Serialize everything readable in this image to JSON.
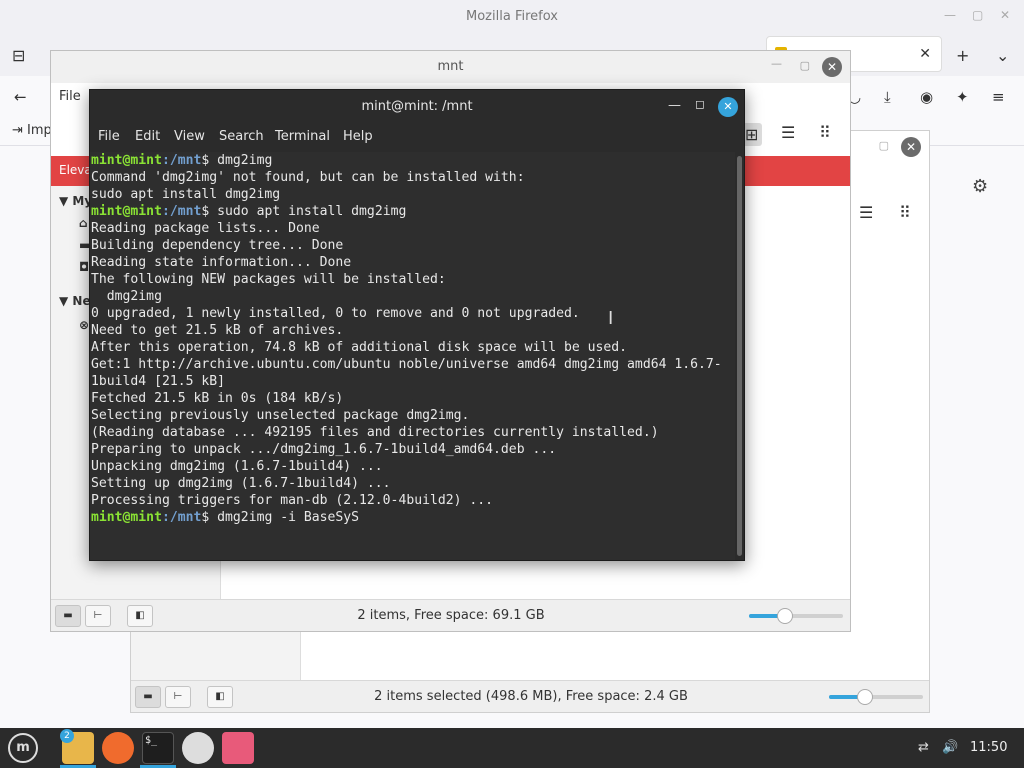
{
  "firefox": {
    "title": "Mozilla Firefox",
    "bookmark": "Imp",
    "tab_close": "✕"
  },
  "nemo_back": {
    "status_text": "2 items selected (498.6 MB), Free space: 2.4 GB",
    "zoom_level": 0.38
  },
  "nemo_mnt": {
    "title": "mnt",
    "menu_file": "File",
    "banner_text": "Eleva",
    "sidebar_group_1": "My",
    "sidebar_group_2": "Ne",
    "status_text": "2 items, Free space: 69.1 GB",
    "zoom_level": 0.38
  },
  "terminal": {
    "title": "mint@mint: /mnt",
    "menu": [
      "File",
      "Edit",
      "View",
      "Search",
      "Terminal",
      "Help"
    ],
    "prompt_user": "mint@mint",
    "prompt_path": ":/mnt",
    "prompt_suffix": "$ ",
    "lines": [
      {
        "type": "cmd",
        "text": "dmg2img"
      },
      {
        "type": "out",
        "text": "Command 'dmg2img' not found, but can be installed with:"
      },
      {
        "type": "out",
        "text": "sudo apt install dmg2img"
      },
      {
        "type": "cmd",
        "text": "sudo apt install dmg2img"
      },
      {
        "type": "out",
        "text": "Reading package lists... Done"
      },
      {
        "type": "out",
        "text": "Building dependency tree... Done"
      },
      {
        "type": "out",
        "text": "Reading state information... Done"
      },
      {
        "type": "out",
        "text": "The following NEW packages will be installed:"
      },
      {
        "type": "out",
        "text": "  dmg2img"
      },
      {
        "type": "out",
        "text": "0 upgraded, 1 newly installed, 0 to remove and 0 not upgraded."
      },
      {
        "type": "out",
        "text": "Need to get 21.5 kB of archives."
      },
      {
        "type": "out",
        "text": "After this operation, 74.8 kB of additional disk space will be used."
      },
      {
        "type": "out",
        "text": "Get:1 http://archive.ubuntu.com/ubuntu noble/universe amd64 dmg2img amd64 1.6.7-"
      },
      {
        "type": "out",
        "text": "1build4 [21.5 kB]"
      },
      {
        "type": "out",
        "text": "Fetched 21.5 kB in 0s (184 kB/s)"
      },
      {
        "type": "out",
        "text": "Selecting previously unselected package dmg2img."
      },
      {
        "type": "out",
        "text": "(Reading database ... 492195 files and directories currently installed.)"
      },
      {
        "type": "out",
        "text": "Preparing to unpack .../dmg2img_1.6.7-1build4_amd64.deb ..."
      },
      {
        "type": "out",
        "text": "Unpacking dmg2img (1.6.7-1build4) ..."
      },
      {
        "type": "out",
        "text": "Setting up dmg2img (1.6.7-1build4) ..."
      },
      {
        "type": "out",
        "text": "Processing triggers for man-db (2.12.0-4build2) ..."
      },
      {
        "type": "cmd",
        "text": "dmg2img -i BaseSyS"
      }
    ]
  },
  "taskbar": {
    "menu_icon": "mint-menu-icon",
    "files_badge": "2",
    "clock": "11:50",
    "apps": [
      "files-icon",
      "firefox-icon",
      "terminal-icon",
      "chromium-icon",
      "image-viewer-icon"
    ]
  },
  "colors": {
    "accent": "#35a4dc",
    "prompt_user": "#8ae234",
    "prompt_path": "#729fcf",
    "banner": "#e24444"
  }
}
